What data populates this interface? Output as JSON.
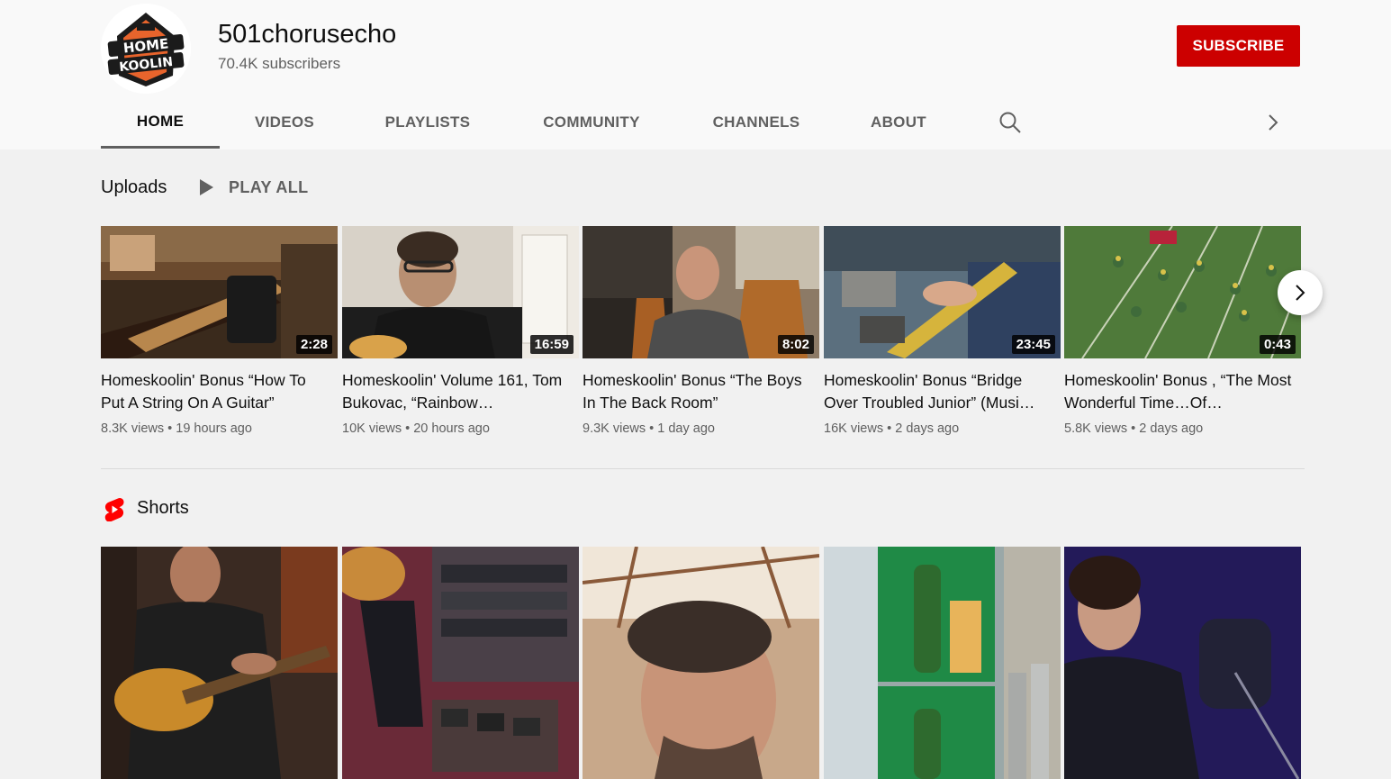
{
  "channel": {
    "name": "501chorusecho",
    "subscribers": "70.4K subscribers",
    "subscribe_label": "SUBSCRIBE",
    "logo_text_top": "HOME",
    "logo_text_bottom": "KOOLIN"
  },
  "tabs": [
    {
      "label": "HOME",
      "active": true
    },
    {
      "label": "VIDEOS"
    },
    {
      "label": "PLAYLISTS"
    },
    {
      "label": "COMMUNITY"
    },
    {
      "label": "CHANNELS"
    },
    {
      "label": "ABOUT"
    }
  ],
  "uploads": {
    "title": "Uploads",
    "play_all": "PLAY ALL",
    "videos": [
      {
        "title": "Homeskoolin' Bonus “How To Put A String On A Guitar”",
        "duration": "2:28",
        "views": "8.3K views",
        "age": "19 hours ago"
      },
      {
        "title": "Homeskoolin' Volume 161, Tom Bukovac, “Rainbow…",
        "duration": "16:59",
        "views": "10K views",
        "age": "20 hours ago"
      },
      {
        "title": "Homeskoolin' Bonus “The Boys In The Back Room”",
        "duration": "8:02",
        "views": "9.3K views",
        "age": "1 day ago"
      },
      {
        "title": "Homeskoolin' Bonus “Bridge Over Troubled Junior” (Musi…",
        "duration": "23:45",
        "views": "16K views",
        "age": "2 days ago"
      },
      {
        "title": "Homeskoolin' Bonus , “The Most Wonderful Time…Of…",
        "duration": "0:43",
        "views": "5.8K views",
        "age": "2 days ago"
      }
    ]
  },
  "shorts": {
    "title": "Shorts"
  },
  "colors": {
    "brand_red": "#cc0000",
    "header_bg": "#f9f9f9",
    "page_bg": "#f1f1f1",
    "secondary_text": "#606060"
  },
  "icons": [
    "search-icon",
    "chevron-right-icon",
    "play-icon",
    "shorts-icon"
  ]
}
